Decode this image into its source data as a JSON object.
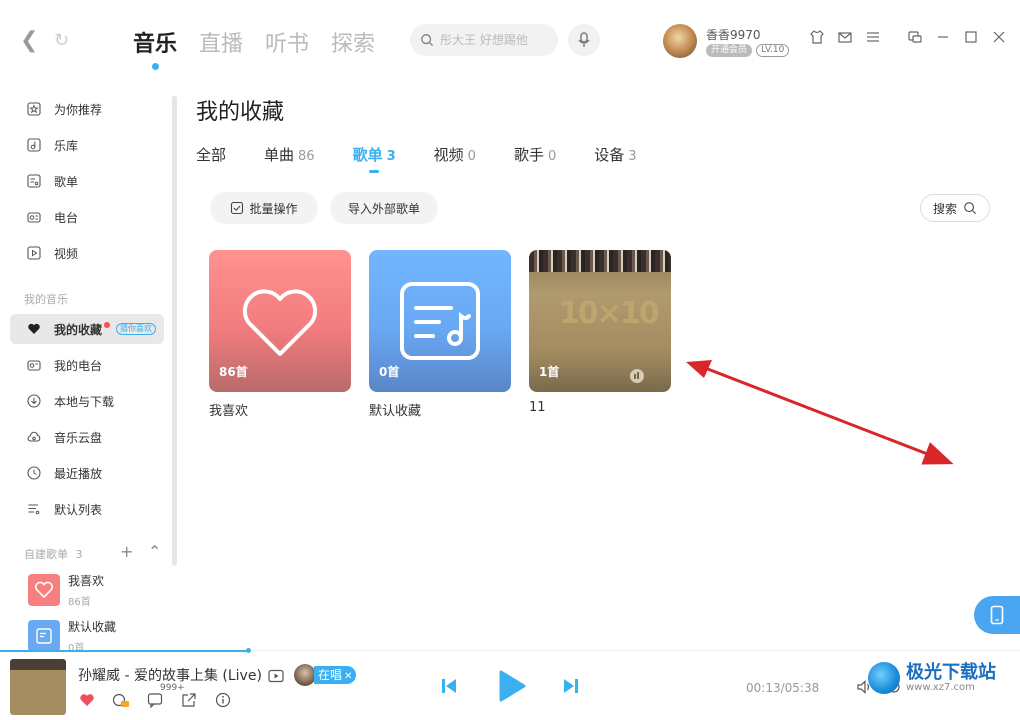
{
  "topbar": {
    "tabs": [
      {
        "label": "音乐",
        "active": true
      },
      {
        "label": "直播",
        "active": false
      },
      {
        "label": "听书",
        "active": false
      },
      {
        "label": "探索",
        "active": false
      }
    ],
    "search_placeholder": "彤大王 好想踢他",
    "username": "香香9970",
    "vip_badge": "开通会员",
    "level_badge": "LV.10"
  },
  "sidebar": {
    "items": [
      {
        "label": "为你推荐",
        "icon": "star-icon"
      },
      {
        "label": "乐库",
        "icon": "music-library-icon"
      },
      {
        "label": "歌单",
        "icon": "playlist-icon"
      },
      {
        "label": "电台",
        "icon": "radio-icon"
      },
      {
        "label": "视频",
        "icon": "video-icon"
      }
    ],
    "my_music_section": "我的音乐",
    "my_items": [
      {
        "label": "我的收藏",
        "icon": "heart-icon",
        "active": true,
        "pill": "猜你喜欢"
      },
      {
        "label": "我的电台",
        "icon": "radio-icon"
      },
      {
        "label": "本地与下载",
        "icon": "download-icon"
      },
      {
        "label": "音乐云盘",
        "icon": "cloud-icon"
      },
      {
        "label": "最近播放",
        "icon": "clock-icon"
      },
      {
        "label": "默认列表",
        "icon": "list-icon"
      }
    ],
    "created_section": "自建歌单",
    "created_count": "3",
    "playlists": [
      {
        "name": "我喜欢",
        "count": "86首"
      },
      {
        "name": "默认收藏",
        "count": "0首"
      }
    ]
  },
  "main": {
    "title": "我的收藏",
    "tabs": [
      {
        "label": "全部",
        "count": ""
      },
      {
        "label": "单曲",
        "count": "86"
      },
      {
        "label": "歌单",
        "count": "3",
        "active": true
      },
      {
        "label": "视频",
        "count": "0"
      },
      {
        "label": "歌手",
        "count": "0"
      },
      {
        "label": "设备",
        "count": "3"
      }
    ],
    "batch_button": "批量操作",
    "import_button": "导入外部歌单",
    "search_button": "搜索",
    "cards": [
      {
        "name": "我喜欢",
        "count": "86首"
      },
      {
        "name": "默认收藏",
        "count": "0首"
      },
      {
        "name": "11",
        "count": "1首"
      }
    ]
  },
  "player": {
    "song": "孙耀威 - 爱的故事上集 (Live)",
    "singing_label": "在唱",
    "comment_count": "999+",
    "time": "00:13/05:38",
    "progress": 0.038
  },
  "watermark": {
    "name": "极光下载站",
    "url": "www.xz7.com"
  },
  "colors": {
    "accent": "#3ab0f0",
    "like_cover": "#f27c7e",
    "default_cover": "#69a8f4",
    "annotation_arrow": "#d9262a"
  }
}
